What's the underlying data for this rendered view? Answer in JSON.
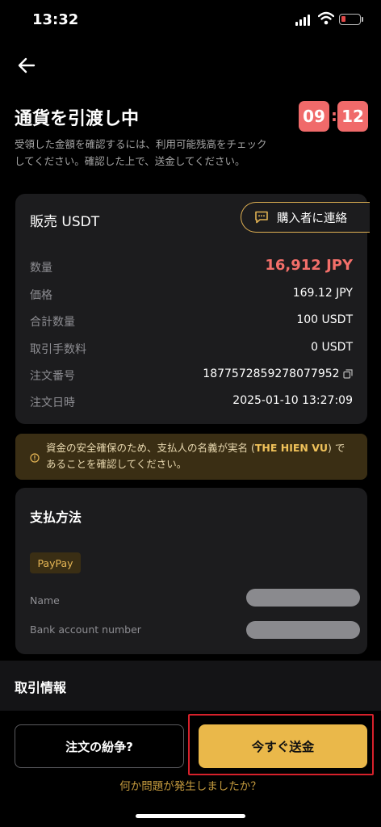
{
  "status_bar": {
    "time": "13:32"
  },
  "header": {
    "title": "通貨を引渡し中",
    "timer_minutes": "09",
    "timer_separator": ":",
    "timer_seconds": "12",
    "instruction": "受領した金額を確認するには、利用可能残高をチェックしてください。確認した上で、送金してください。"
  },
  "order": {
    "title": "販売 USDT",
    "contact_label": "購入者に連絡",
    "rows": [
      {
        "label": "数量",
        "value": "16,912 JPY"
      },
      {
        "label": "価格",
        "value": "169.12 JPY"
      },
      {
        "label": "合計数量",
        "value": "100 USDT"
      },
      {
        "label": "取引手数料",
        "value": "0 USDT"
      },
      {
        "label": "注文番号",
        "value": "1877572859278077952"
      },
      {
        "label": "注文日時",
        "value": "2025-01-10 13:27:09"
      }
    ]
  },
  "warning": {
    "text_before": "資金の安全確保のため、支払人の名義が実名 (",
    "name": "THE HIEN VU",
    "text_after": ") であることを確認してください。"
  },
  "payment": {
    "title": "支払方法",
    "method": "PayPay",
    "name_label": "Name",
    "account_label": "Bank account number"
  },
  "trade_info": {
    "title": "取引情報"
  },
  "actions": {
    "dispute_label": "注文の紛争?",
    "send_label": "今すぐ送金",
    "problem_link": "何か問題が発生しましたか？"
  },
  "colors": {
    "accent": "#eab84a",
    "timer": "#f06a6a",
    "amount": "#f36f6a",
    "highlight": "#d6212b"
  }
}
